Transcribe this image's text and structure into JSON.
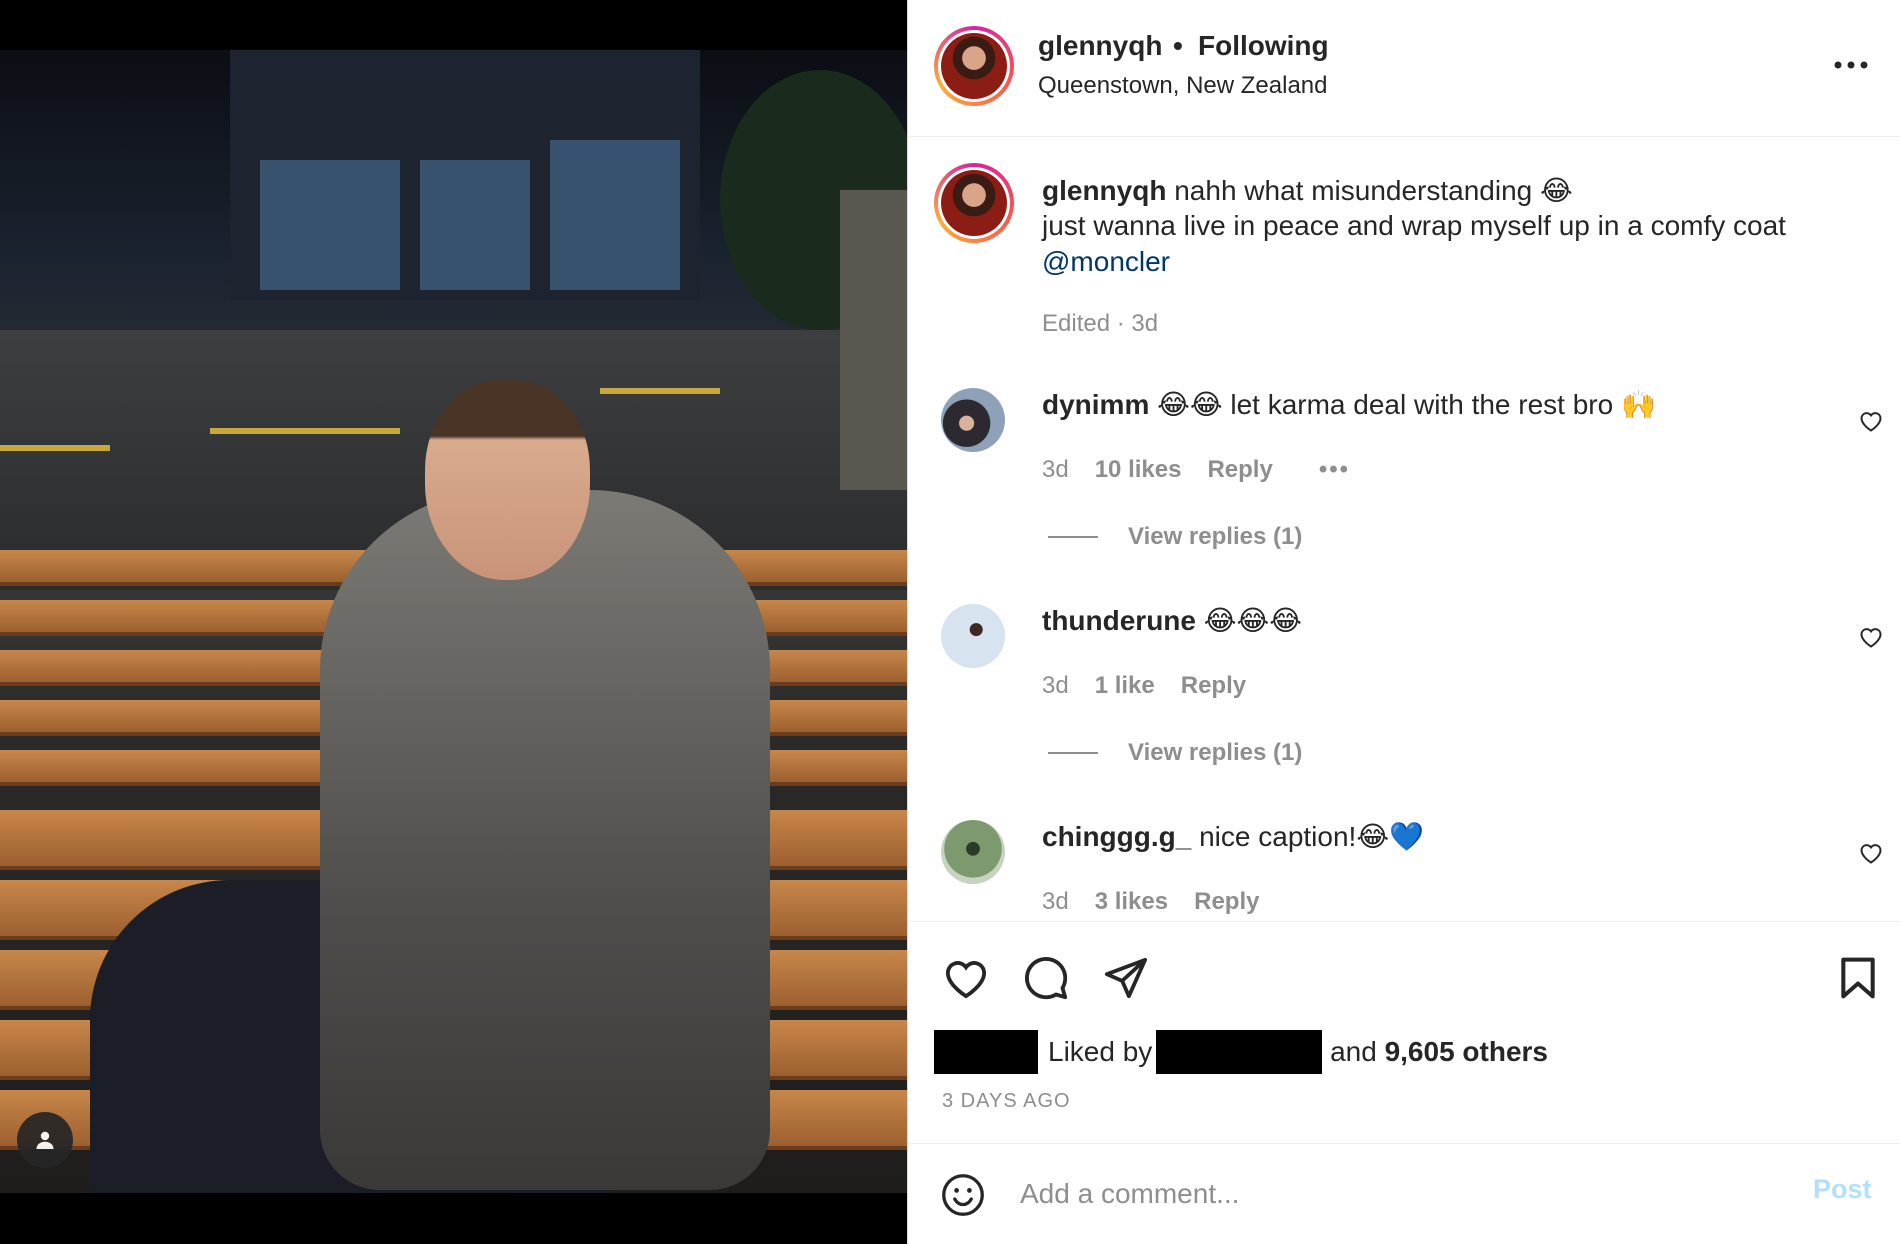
{
  "post": {
    "username": "glennyqh",
    "separator": "•",
    "following_label": "Following",
    "location": "Queenstown, New Zealand"
  },
  "caption": {
    "username": "glennyqh",
    "line1": " nahh what misunderstanding 😂",
    "line2": "just wanna live in peace and wrap myself up in a comfy coat",
    "mention": "@moncler",
    "edited": "Edited",
    "dot": " · ",
    "age": "3d"
  },
  "comments": [
    {
      "username": "dynimm",
      "text": " 😂😂 let karma deal with the rest bro 🙌",
      "age": "3d",
      "likes": "10 likes",
      "reply": "Reply",
      "more": "•••",
      "view_replies": "View replies (1)"
    },
    {
      "username": "thunderune",
      "text": " 😂😂😂",
      "age": "3d",
      "likes": "1 like",
      "reply": "Reply",
      "view_replies": "View replies (1)"
    },
    {
      "username": "chinggg.g_",
      "text": " nice caption!😂💙",
      "age": "3d",
      "likes": "3 likes",
      "reply": "Reply"
    }
  ],
  "actions": {
    "liked_by_label": "Liked by",
    "and_label": " and ",
    "others_count": "9,605 others",
    "time_ago": "3 DAYS AGO"
  },
  "comment_box": {
    "placeholder": "Add a comment...",
    "post_label": "Post"
  },
  "icons": {
    "more": "more-horizontal-icon",
    "like": "heart-icon",
    "comment": "comment-bubble-icon",
    "share": "paper-plane-icon",
    "save": "bookmark-icon",
    "emoji": "smiley-face-icon",
    "user_tag": "person-icon"
  },
  "colors": {
    "link_blue": "#00376b",
    "post_disabled": "#b2dffc",
    "secondary_text": "#8e8e8e"
  }
}
